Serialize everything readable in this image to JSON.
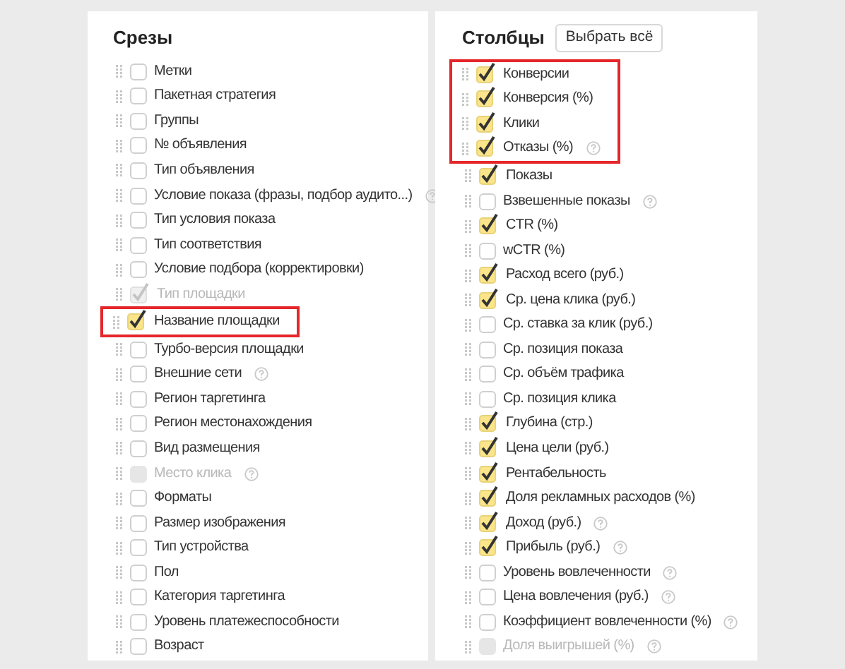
{
  "sections": [
    {
      "title": "Срезы",
      "groups": [
        {
          "items": [
            {
              "label": "Метки",
              "checked": false,
              "disabled": false
            },
            {
              "label": "Пакетная стратегия",
              "checked": false,
              "disabled": false
            },
            {
              "label": "Группы",
              "checked": false,
              "disabled": false
            },
            {
              "label": "№ объявления",
              "checked": false,
              "disabled": false
            },
            {
              "label": "Тип объявления",
              "checked": false,
              "disabled": false
            },
            {
              "label": "Условие показа (фразы, подбор аудито...)",
              "checked": false,
              "disabled": false,
              "hint": true
            },
            {
              "label": "Тип условия показа",
              "checked": false,
              "disabled": false
            },
            {
              "label": "Тип соответствия",
              "checked": false,
              "disabled": false
            },
            {
              "label": "Условие подбора (корректировки)",
              "checked": false,
              "disabled": false
            },
            {
              "label": "Тип площадки",
              "checked": true,
              "disabled": true
            }
          ]
        },
        {
          "highlighted": true,
          "items": [
            {
              "label": "Название площадки",
              "checked": true,
              "disabled": false
            }
          ]
        },
        {
          "items": [
            {
              "label": "Турбо-версия площадки",
              "checked": false,
              "disabled": false
            },
            {
              "label": "Внешние сети",
              "checked": false,
              "disabled": false,
              "hint": true
            },
            {
              "label": "Регион таргетинга",
              "checked": false,
              "disabled": false
            },
            {
              "label": "Регион местонахождения",
              "checked": false,
              "disabled": false
            },
            {
              "label": "Вид размещения",
              "checked": false,
              "disabled": false
            },
            {
              "label": "Место клика",
              "checked": false,
              "disabled": true,
              "hint": true
            },
            {
              "label": "Форматы",
              "checked": false,
              "disabled": false
            },
            {
              "label": "Размер изображения",
              "checked": false,
              "disabled": false
            },
            {
              "label": "Тип устройства",
              "checked": false,
              "disabled": false
            },
            {
              "label": "Пол",
              "checked": false,
              "disabled": false
            },
            {
              "label": "Категория таргетинга",
              "checked": false,
              "disabled": false
            },
            {
              "label": "Уровень платежеспособности",
              "checked": false,
              "disabled": false
            },
            {
              "label": "Возраст",
              "checked": false,
              "disabled": false
            }
          ]
        }
      ]
    },
    {
      "title": "Столбцы",
      "button": "Выбрать всё",
      "groups": [
        {
          "highlighted": true,
          "items": [
            {
              "label": "Конверсии",
              "checked": true,
              "disabled": false
            },
            {
              "label": "Конверсия (%)",
              "checked": true,
              "disabled": false
            },
            {
              "label": "Клики",
              "checked": true,
              "disabled": false
            },
            {
              "label": "Отказы (%)",
              "checked": true,
              "disabled": false,
              "hint": true
            }
          ]
        },
        {
          "items": [
            {
              "label": "Показы",
              "checked": true,
              "disabled": false
            },
            {
              "label": "Взвешенные показы",
              "checked": false,
              "disabled": false,
              "hint": true
            },
            {
              "label": "CTR (%)",
              "checked": true,
              "disabled": false
            },
            {
              "label": "wCTR (%)",
              "checked": false,
              "disabled": false
            },
            {
              "label": "Расход всего (руб.)",
              "checked": true,
              "disabled": false
            },
            {
              "label": "Ср. цена клика (руб.)",
              "checked": true,
              "disabled": false
            },
            {
              "label": "Ср. ставка за клик (руб.)",
              "checked": false,
              "disabled": false
            },
            {
              "label": "Ср. позиция показа",
              "checked": false,
              "disabled": false
            },
            {
              "label": "Ср. объём трафика",
              "checked": false,
              "disabled": false
            },
            {
              "label": "Ср. позиция клика",
              "checked": false,
              "disabled": false
            },
            {
              "label": "Глубина (стр.)",
              "checked": true,
              "disabled": false
            },
            {
              "label": "Цена цели (руб.)",
              "checked": true,
              "disabled": false
            },
            {
              "label": "Рентабельность",
              "checked": true,
              "disabled": false
            },
            {
              "label": "Доля рекламных расходов (%)",
              "checked": true,
              "disabled": false
            },
            {
              "label": "Доход (руб.)",
              "checked": true,
              "disabled": false,
              "hint": true
            },
            {
              "label": "Прибыль (руб.)",
              "checked": true,
              "disabled": false,
              "hint": true
            },
            {
              "label": "Уровень вовлеченности",
              "checked": false,
              "disabled": false,
              "hint": true
            },
            {
              "label": "Цена вовлечения (руб.)",
              "checked": false,
              "disabled": false,
              "hint": true
            },
            {
              "label": "Коэффициент вовлеченности (%)",
              "checked": false,
              "disabled": false,
              "hint": true
            },
            {
              "label": "Доля выигрышей (%)",
              "checked": false,
              "disabled": true,
              "hint": true
            }
          ]
        }
      ]
    }
  ]
}
